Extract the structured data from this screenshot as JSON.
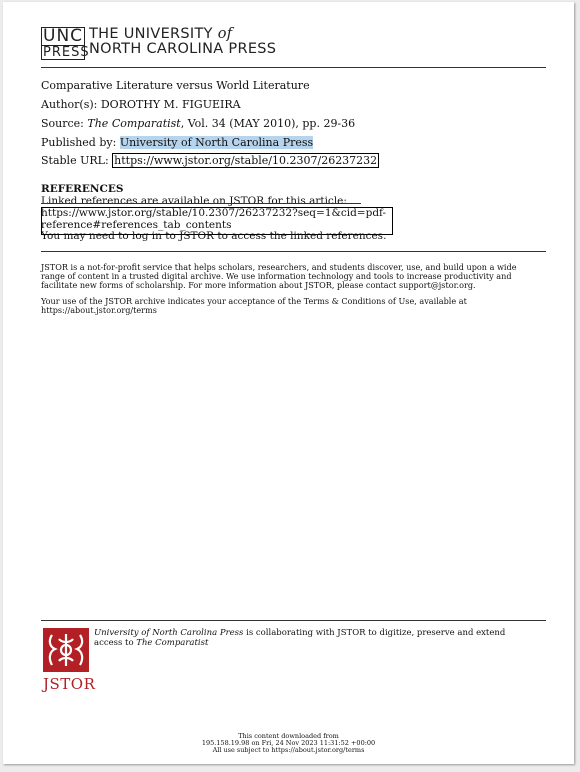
{
  "publisher": {
    "logo_top": "UNC",
    "logo_bottom": "PRESS",
    "name_line1_prefix": "THE UNIVERSITY ",
    "name_line1_of": "of",
    "name_line2": "NORTH CAROLINA PRESS"
  },
  "citation": {
    "title": "Comparative Literature versus World Literature",
    "authors_label": "Author(s):",
    "authors": "DOROTHY M. FIGUEIRA",
    "source_label": "Source:",
    "source_journal": "The Comparatist",
    "source_rest": ", Vol. 34 (MAY 2010), pp. 29-36",
    "published_label": "Published by:",
    "published_by": "University of North Carolina Press",
    "stable_label": "Stable URL:",
    "stable_url": "https://www.jstor.org/stable/10.2307/26237232"
  },
  "references": {
    "heading": "REFERENCES",
    "line1": "Linked references are available on JSTOR for this article:",
    "link_line1": "https://www.jstor.org/stable/10.2307/26237232?seq=1&cid=pdf-",
    "link_line2": "reference#references_tab_contents",
    "note": "You may need to log in to JSTOR to access the linked references."
  },
  "terms": {
    "paragraph1": "JSTOR is a not-for-profit service that helps scholars, researchers, and students discover, use, and build upon a wide range of content in a trusted digital archive. We use information technology and tools to increase productivity and facilitate new forms of scholarship. For more information about JSTOR, please contact support@jstor.org.",
    "paragraph2": "Your use of the JSTOR archive indicates your acceptance of the Terms & Conditions of Use, available at https://about.jstor.org/terms"
  },
  "collaboration": {
    "publisher_italic": "University of North Carolina Press",
    "text": " is collaborating with JSTOR to digitize, preserve and extend access to ",
    "journal_italic": "The Comparatist",
    "jstor_word": "JSTOR"
  },
  "footer": {
    "line1": "This content downloaded from",
    "line2": "195.158.19.98 on Fri, 24 Nov 2023 11:31:52 +00:00",
    "line3": "All use subject to https://about.jstor.org/terms"
  }
}
